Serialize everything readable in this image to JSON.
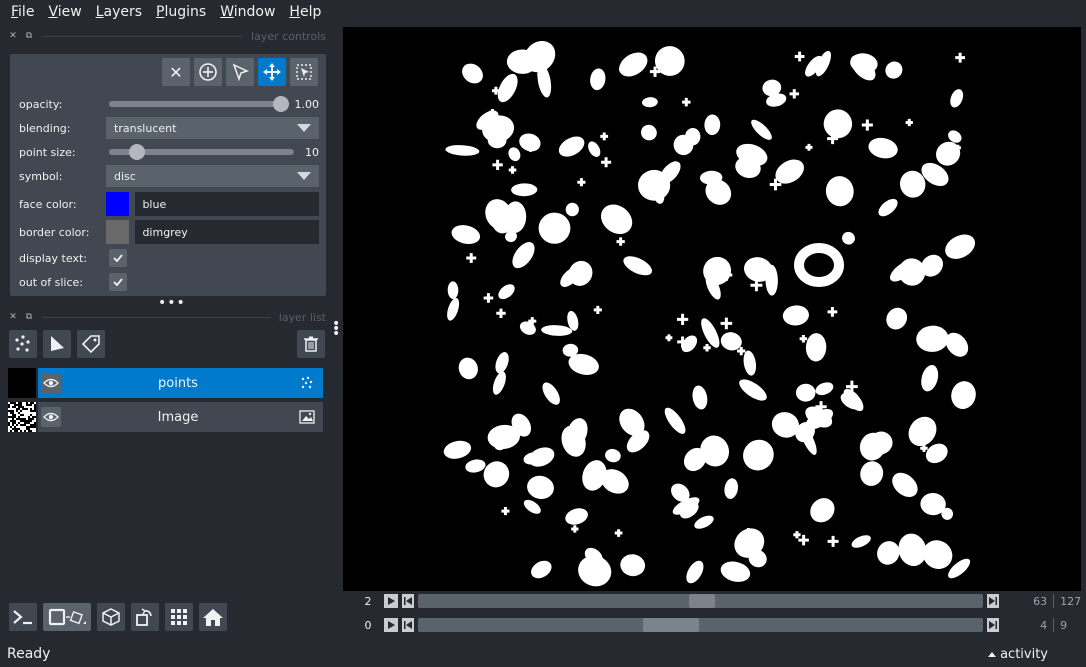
{
  "menu": [
    {
      "mnemonic": "F",
      "rest": "ile"
    },
    {
      "mnemonic": "V",
      "rest": "iew"
    },
    {
      "mnemonic": "L",
      "rest": "ayers"
    },
    {
      "mnemonic": "P",
      "rest": "lugins"
    },
    {
      "mnemonic": "W",
      "rest": "indow"
    },
    {
      "mnemonic": "H",
      "rest": "elp"
    }
  ],
  "layer_controls": {
    "title": "layer controls",
    "opacity": {
      "label": "opacity:",
      "value": "1.00",
      "fraction": 1.0
    },
    "blending": {
      "label": "blending:",
      "value": "translucent"
    },
    "point_size": {
      "label": "point size:",
      "value": "10",
      "fraction": 0.12
    },
    "symbol": {
      "label": "symbol:",
      "value": "disc"
    },
    "face_color": {
      "label": "face color:",
      "value": "blue",
      "swatch": "#0000ff"
    },
    "border_color": {
      "label": "border color:",
      "value": "dimgrey",
      "swatch": "#696969"
    },
    "display_text": {
      "label": "display text:"
    },
    "out_of_slice": {
      "label": "out of slice:"
    }
  },
  "layer_list": {
    "title": "layer list",
    "layers": [
      {
        "name": "points",
        "type_icon": "points-icon",
        "selected": true
      },
      {
        "name": "Image",
        "type_icon": "image-icon",
        "selected": false
      }
    ]
  },
  "dims": [
    {
      "axis": "2",
      "current": "63",
      "max": "127",
      "position": 0.5
    },
    {
      "axis": "0",
      "current": "4",
      "max": "9",
      "position": 0.44
    }
  ],
  "status": {
    "text": "Ready",
    "activity": "activity"
  },
  "colors": {
    "accent": "#007acc",
    "background": "#262930",
    "panel": "#414851"
  }
}
